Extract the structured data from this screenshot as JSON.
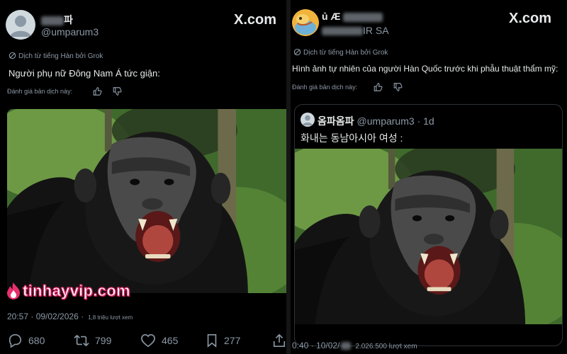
{
  "left_post": {
    "author_name_visible": "파",
    "handle": "@umparum3",
    "brand": "X.com",
    "grok_note": "Dịch từ tiếng Hàn bởi Grok",
    "text": "Người phụ nữ Đông Nam Á tức giận:",
    "rate_prompt": "Đánh giá bản dịch này:",
    "timestamp": "20:57 · 09/02/2026 ·",
    "views": "1,8 triệu lượt xem",
    "stats": {
      "replies": "680",
      "reposts": "799",
      "likes": "465",
      "bookmarks": "277"
    },
    "watermark": "tinhayvip.com"
  },
  "right_post": {
    "author_name_visible": "ủ Æ",
    "handle_visible": "IR   SA",
    "brand": "X.com",
    "grok_note": "Dịch từ tiếng Hàn bởi Grok",
    "text": "Hình ảnh tự nhiên của người Hàn Quốc trước khi phẫu thuật thẩm mỹ:",
    "rate_prompt": "Đánh giá bản dịch này:",
    "quoted": {
      "name": "옴파옴파",
      "handle": "@umparum3 · 1d",
      "text": "화내는 동남아시아 여성 :"
    },
    "timestamp": "0:40 · 10/02/",
    "views": "2.026.500 lượt xem"
  },
  "colors": {
    "background": "#000000",
    "text": "#e7e9ea",
    "muted": "#8b98a5",
    "watermark_accent": "#d11f5d"
  }
}
